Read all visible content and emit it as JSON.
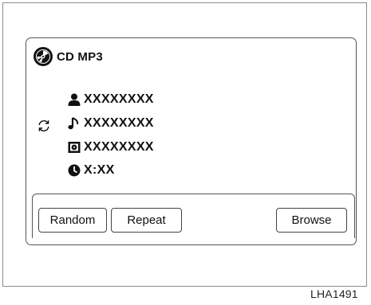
{
  "screen": {
    "source_label": "CD MP3",
    "disc_icon": "cd-disc-icon",
    "info_rows": [
      {
        "icon": "artist-person-icon",
        "value": "XXXXXXXX"
      },
      {
        "icon": "song-music-note-icon",
        "value": "XXXXXXXX"
      },
      {
        "icon": "album-disc-square-icon",
        "value": "XXXXXXXX"
      },
      {
        "icon": "clock-icon",
        "value": "X:XX"
      }
    ],
    "repeat_indicator_icon": "repeat-cycle-icon"
  },
  "buttons": {
    "random": "Random",
    "repeat": "Repeat",
    "browse": "Browse"
  },
  "caption": "LHA1491"
}
